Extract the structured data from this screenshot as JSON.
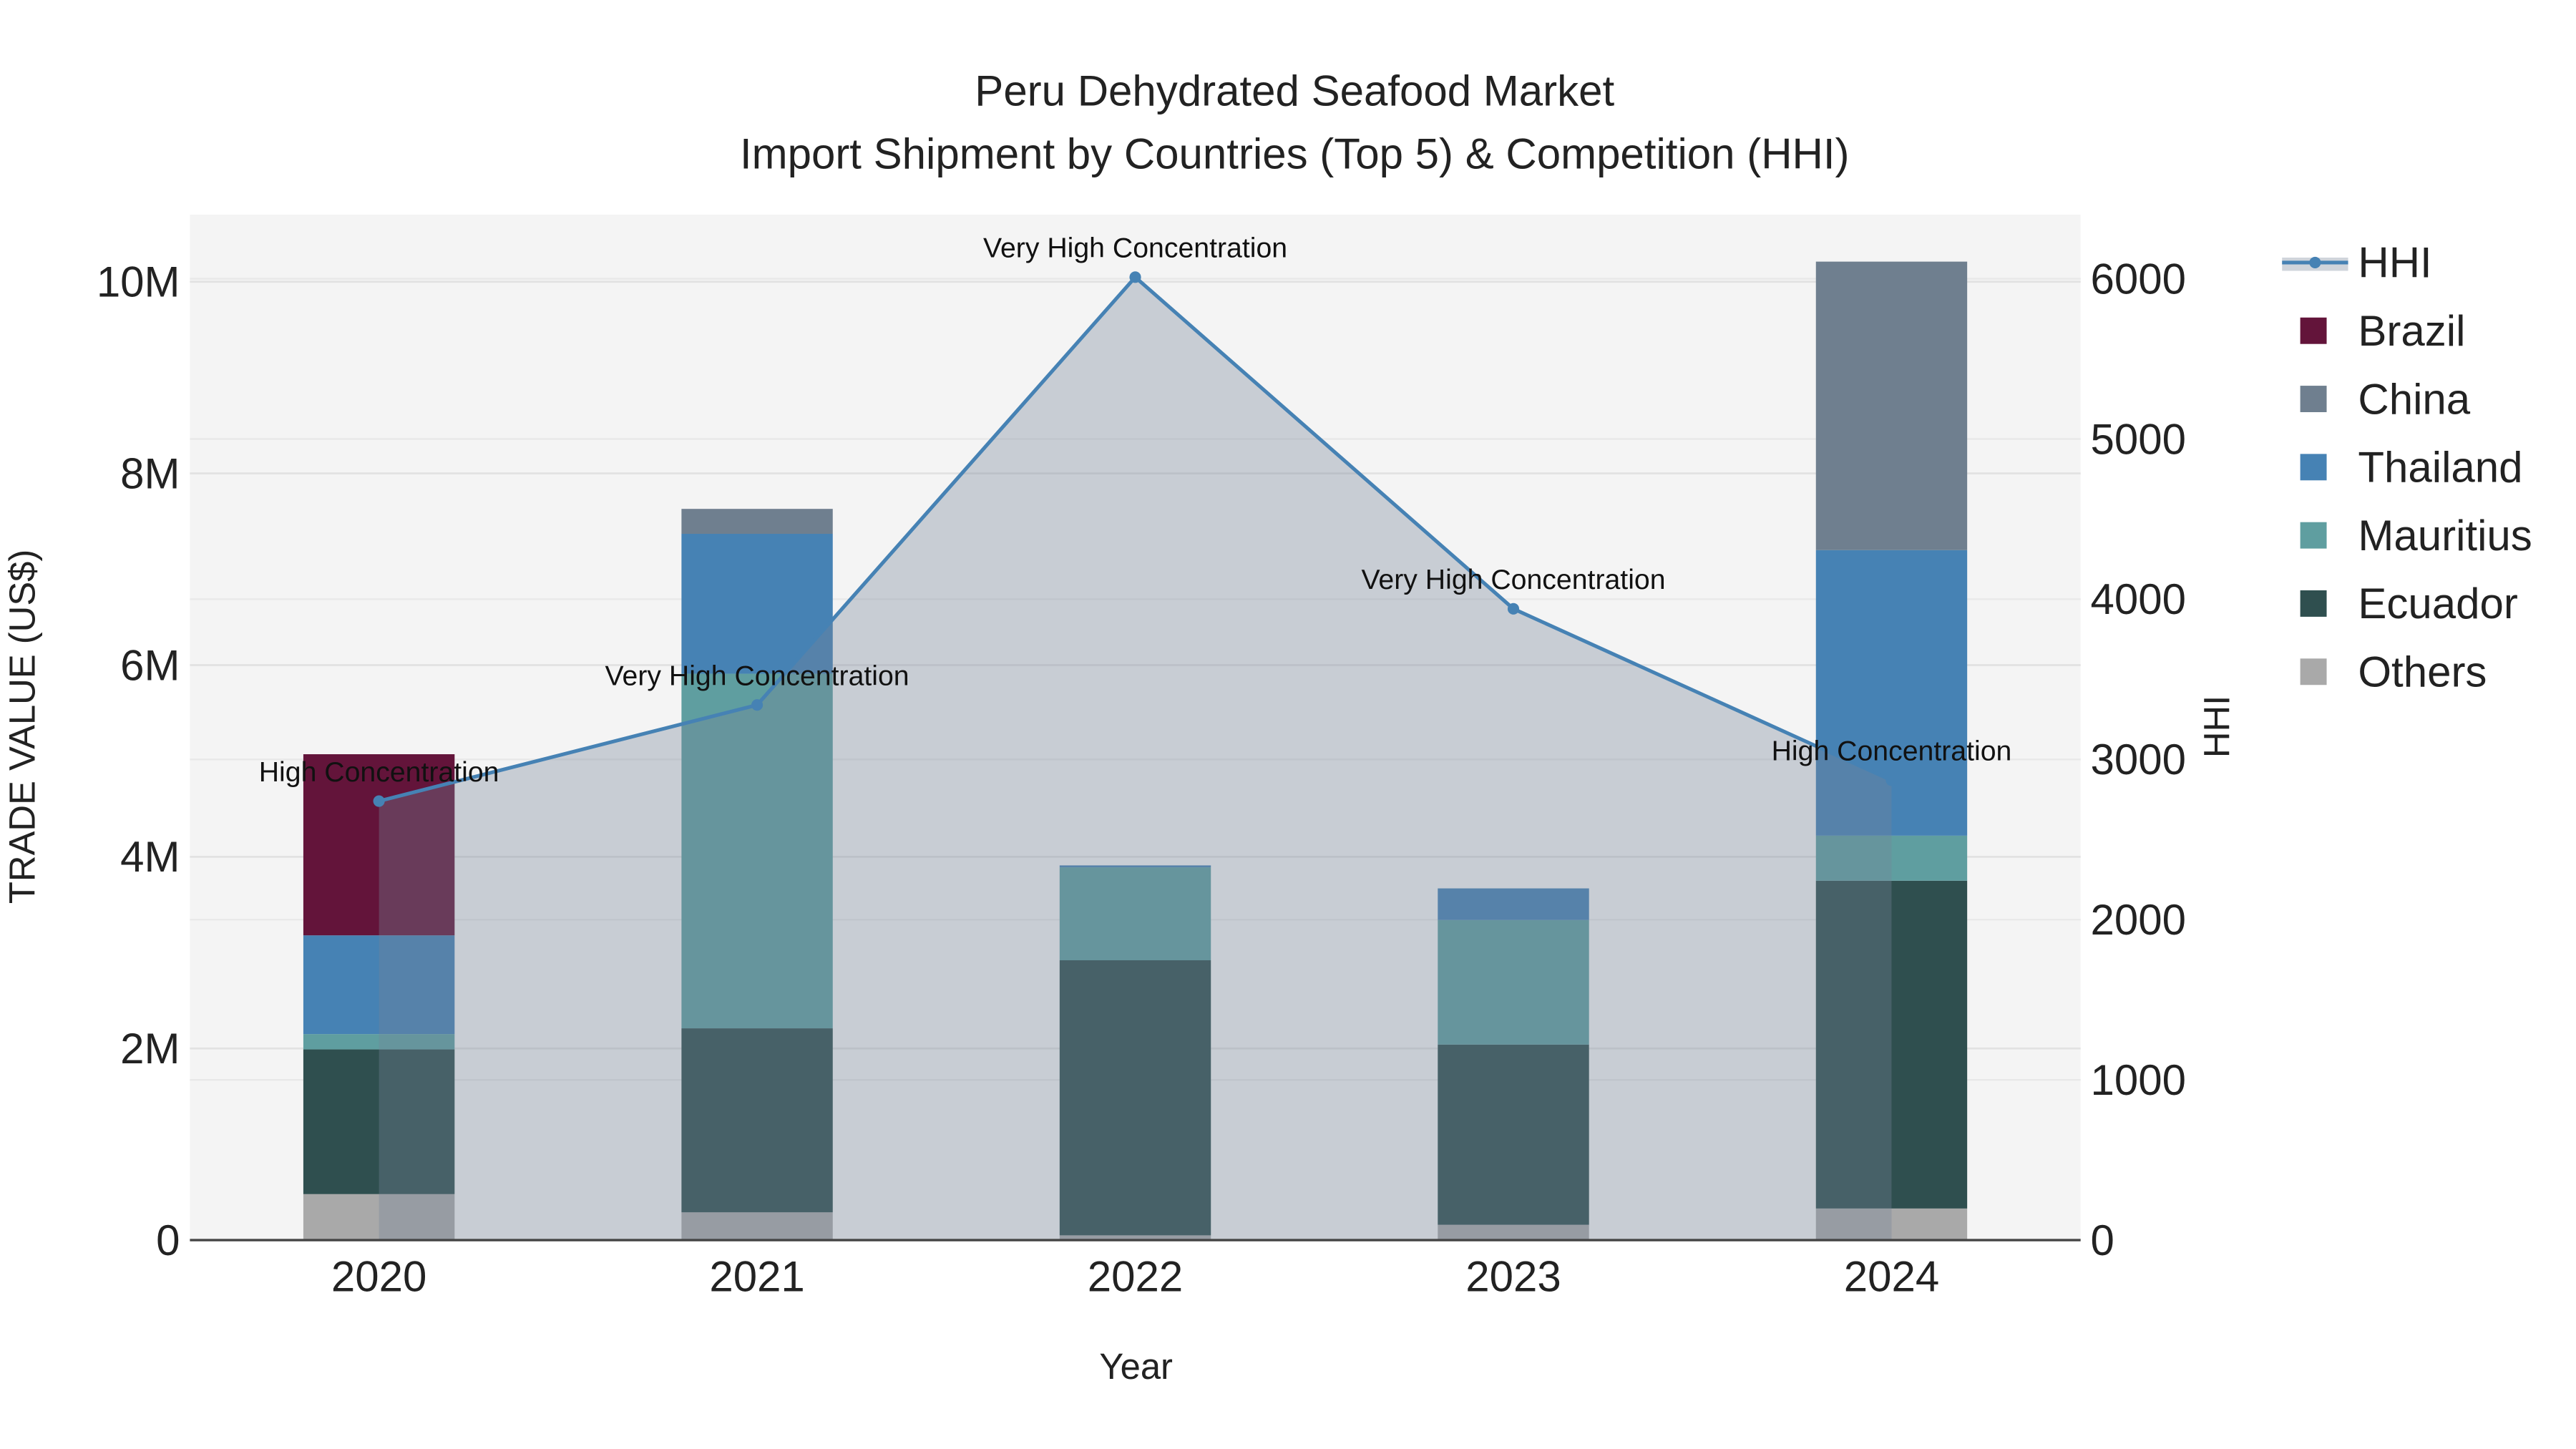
{
  "chart_data": {
    "type": "bar",
    "title": "Peru Dehydrated Seafood Market",
    "subtitle": "Import Shipment by Countries (Top 5) & Competition (HHI)",
    "xlabel": "Year",
    "ylabel": "TRADE VALUE (US$)",
    "y2label": "HHI",
    "categories": [
      "2020",
      "2021",
      "2022",
      "2023",
      "2024"
    ],
    "ylim": [
      0,
      10700000
    ],
    "y2lim": [
      0,
      6400
    ],
    "yticks": [
      {
        "v": 0,
        "label": "0"
      },
      {
        "v": 2000000,
        "label": "2M"
      },
      {
        "v": 4000000,
        "label": "4M"
      },
      {
        "v": 6000000,
        "label": "6M"
      },
      {
        "v": 8000000,
        "label": "8M"
      },
      {
        "v": 10000000,
        "label": "10M"
      }
    ],
    "y2ticks": [
      {
        "v": 0,
        "label": "0"
      },
      {
        "v": 1000,
        "label": "1000"
      },
      {
        "v": 2000,
        "label": "2000"
      },
      {
        "v": 3000,
        "label": "3000"
      },
      {
        "v": 4000,
        "label": "4000"
      },
      {
        "v": 5000,
        "label": "5000"
      },
      {
        "v": 6000,
        "label": "6000"
      }
    ],
    "stacked": true,
    "series": [
      {
        "name": "Others",
        "color": "#a9a9a9",
        "values": [
          480000,
          290000,
          50000,
          160000,
          330000
        ]
      },
      {
        "name": "Ecuador",
        "color": "#2f4f4f",
        "values": [
          1510000,
          1920000,
          2870000,
          1880000,
          3420000
        ]
      },
      {
        "name": "Mauritius",
        "color": "#5f9ea0",
        "values": [
          160000,
          3700000,
          970000,
          1300000,
          470000
        ]
      },
      {
        "name": "Thailand",
        "color": "#4682b4",
        "values": [
          1030000,
          1460000,
          20000,
          330000,
          2980000
        ]
      },
      {
        "name": "China",
        "color": "#6f7f8f",
        "values": [
          0,
          260000,
          0,
          0,
          3010000
        ]
      },
      {
        "name": "Brazil",
        "color": "#63143a",
        "values": [
          1890000,
          0,
          0,
          0,
          0
        ]
      }
    ],
    "line": {
      "name": "HHI",
      "color": "#4682b4",
      "values": [
        2740,
        3340,
        6010,
        3940,
        2870
      ],
      "axis": "right"
    },
    "annotations": [
      "High Concentration",
      "Very High Concentration",
      "Very High Concentration",
      "Very High Concentration",
      "High Concentration"
    ],
    "legend": [
      "HHI",
      "Brazil",
      "China",
      "Thailand",
      "Mauritius",
      "Ecuador",
      "Others"
    ],
    "legend_position": "right",
    "grid": true
  }
}
